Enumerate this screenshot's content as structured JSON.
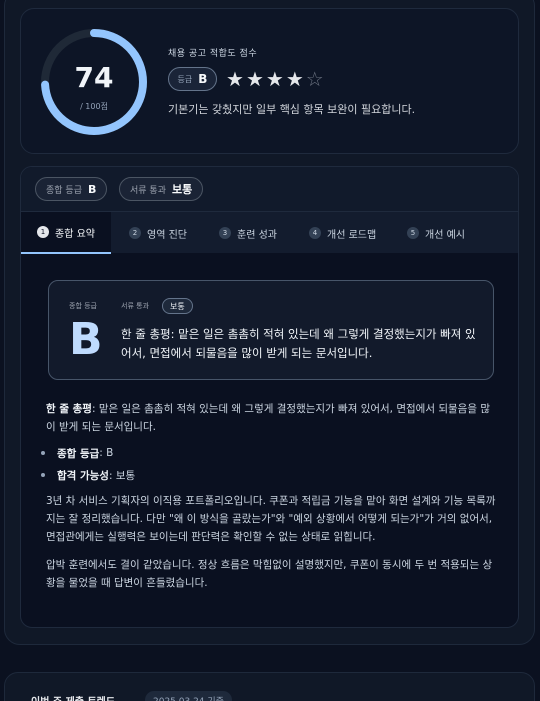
{
  "score": {
    "value": "74",
    "sub": "/ 100점",
    "fraction": 0.74,
    "title": "채용 공고 적합도 점수",
    "grade_label": "등급",
    "grade": "B",
    "stars_filled": 4,
    "stars_total": 5,
    "description": "기본기는 갖췄지만 일부 핵심 항목 보완이 필요합니다."
  },
  "report": {
    "chip_grade_label": "종합 등급",
    "chip_grade_value": "B",
    "chip_pass_label": "서류 통과",
    "chip_pass_value": "보통",
    "tabs": [
      {
        "num": "1",
        "label": "종합 요약"
      },
      {
        "num": "2",
        "label": "영역 진단"
      },
      {
        "num": "3",
        "label": "훈련 성과"
      },
      {
        "num": "4",
        "label": "개선 로드맵"
      },
      {
        "num": "5",
        "label": "개선 예시"
      }
    ],
    "summary": {
      "grade_label": "종합 등급",
      "pass_label": "서류 통과",
      "pass_value": "보통",
      "grade": "B",
      "text": "한 줄 총평: 맡은 일은 촘촘히 적혀 있는데 왜 그렇게 결정했는지가 빠져 있어서, 면접에서 되물음을 많이 받게 되는 문서입니다."
    },
    "oneline_label": "한 줄 총평",
    "oneline_text": ": 맡은 일은 촘촘히 적혀 있는데 왜 그렇게 결정했는지가 빠져 있어서, 면접에서 되물음을 많이 받게 되는 문서입니다.",
    "bullets": [
      {
        "label": "종합 등급",
        "value": ": B"
      },
      {
        "label": "합격 가능성",
        "value": ": 보통"
      }
    ],
    "para1": "3년 차 서비스 기획자의 이직용 포트폴리오입니다. 쿠폰과 적립금 기능을 맡아 화면 설계와 기능 목록까지는 잘 정리했습니다. 다만 \"왜 이 방식을 골랐는가\"와 \"예외 상황에서 어떻게 되는가\"가 거의 없어서, 면접관에게는 실행력은 보이는데 판단력은 확인할 수 없는 상태로 읽힙니다.",
    "para2": "압박 훈련에서도 결이 같았습니다. 정상 흐름은 막힘없이 설명했지만, 쿠폰이 동시에 두 번 적용되는 상황을 물었을 때 답변이 흔들렸습니다."
  },
  "next": {
    "title": "이번 주 제출 트렌드",
    "date": "2025.03.24 기준"
  },
  "colors": {
    "gauge_track": "#1f2937",
    "gauge_fill": "#93c5fd",
    "accent": "#93c5fd"
  }
}
